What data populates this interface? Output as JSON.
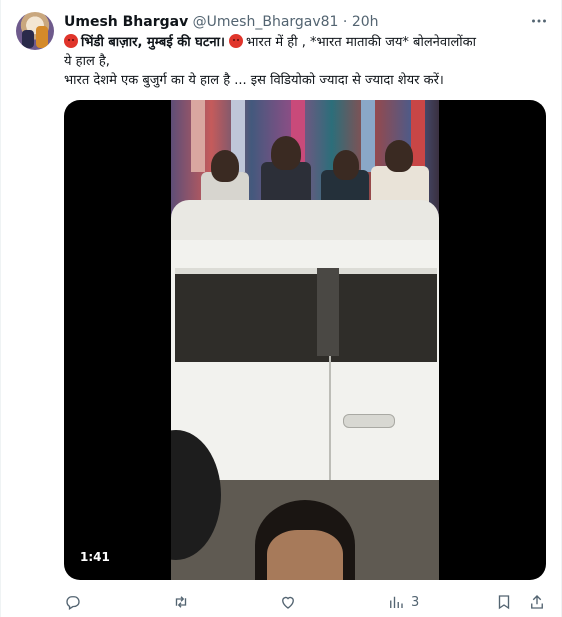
{
  "tweet": {
    "author_name": "Umesh Bhargav",
    "author_handle": "@Umesh_Bhargav81",
    "separator": "·",
    "time_ago": "20h",
    "text_line1_bold": "भिंडी बाज़ार, मुम्बई  की घटना।",
    "text_line1_rest": "भारत में ही , *भारत माताकी जय* बोलनेवालोंका",
    "text_line2": "ये हाल है,",
    "text_line3": "भारत देशमे एक बुजुर्ग का ये हाल है ...  इस विडियोको ज्यादा से ज्यादा शेयर करें।"
  },
  "media": {
    "duration": "1:41"
  },
  "actions": {
    "reply_count": "",
    "retweet_count": "",
    "like_count": "",
    "views_count": "3"
  },
  "icons": {
    "more": "more-dots-icon",
    "reply": "reply-icon",
    "retweet": "retweet-icon",
    "like": "heart-icon",
    "views": "analytics-icon",
    "bookmark": "bookmark-icon",
    "share": "share-icon"
  },
  "colors": {
    "text_primary": "#0f1419",
    "text_secondary": "#536471",
    "emoji_red": "#e0352b"
  }
}
